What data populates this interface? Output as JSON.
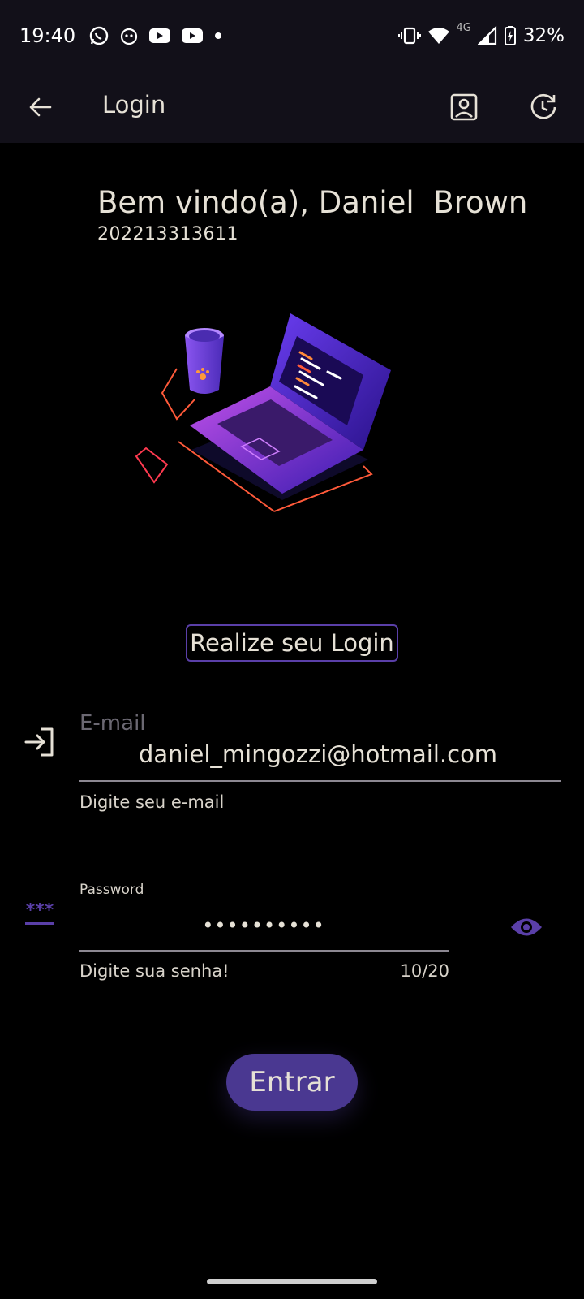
{
  "status_bar": {
    "time": "19:40",
    "network": "4G",
    "battery": "32%",
    "left_icons": [
      "whatsapp-icon",
      "cat-app-icon",
      "youtube-icon",
      "youtube-icon",
      "dot-icon"
    ],
    "right_icons": [
      "vibrate-icon",
      "wifi-icon",
      "signal-icon",
      "battery-charging-icon"
    ]
  },
  "app_bar": {
    "title": "Login",
    "back_icon": "arrow-back-icon",
    "profile_icon": "account-box-icon",
    "history_icon": "history-icon"
  },
  "welcome": {
    "title": "Bem vindo(a), Daniel  Brown",
    "id": "202213313611"
  },
  "login_heading": "Realize seu Login",
  "email": {
    "label": "E-mail",
    "value": "daniel_mingozzi@hotmail.com",
    "helper": "Digite seu e-mail",
    "icon": "login-icon"
  },
  "password": {
    "label": "Password",
    "value": "••••••••••",
    "helper": "Digite sua senha!",
    "counter": "10/20",
    "icon": "password-icon",
    "toggle_icon": "eye-icon"
  },
  "enter_button": "Entrar",
  "colors": {
    "background": "#000000",
    "bar": "#121019",
    "accent": "#4a3891",
    "accent_light": "#5a3fa8",
    "text": "#e6e1d6"
  }
}
